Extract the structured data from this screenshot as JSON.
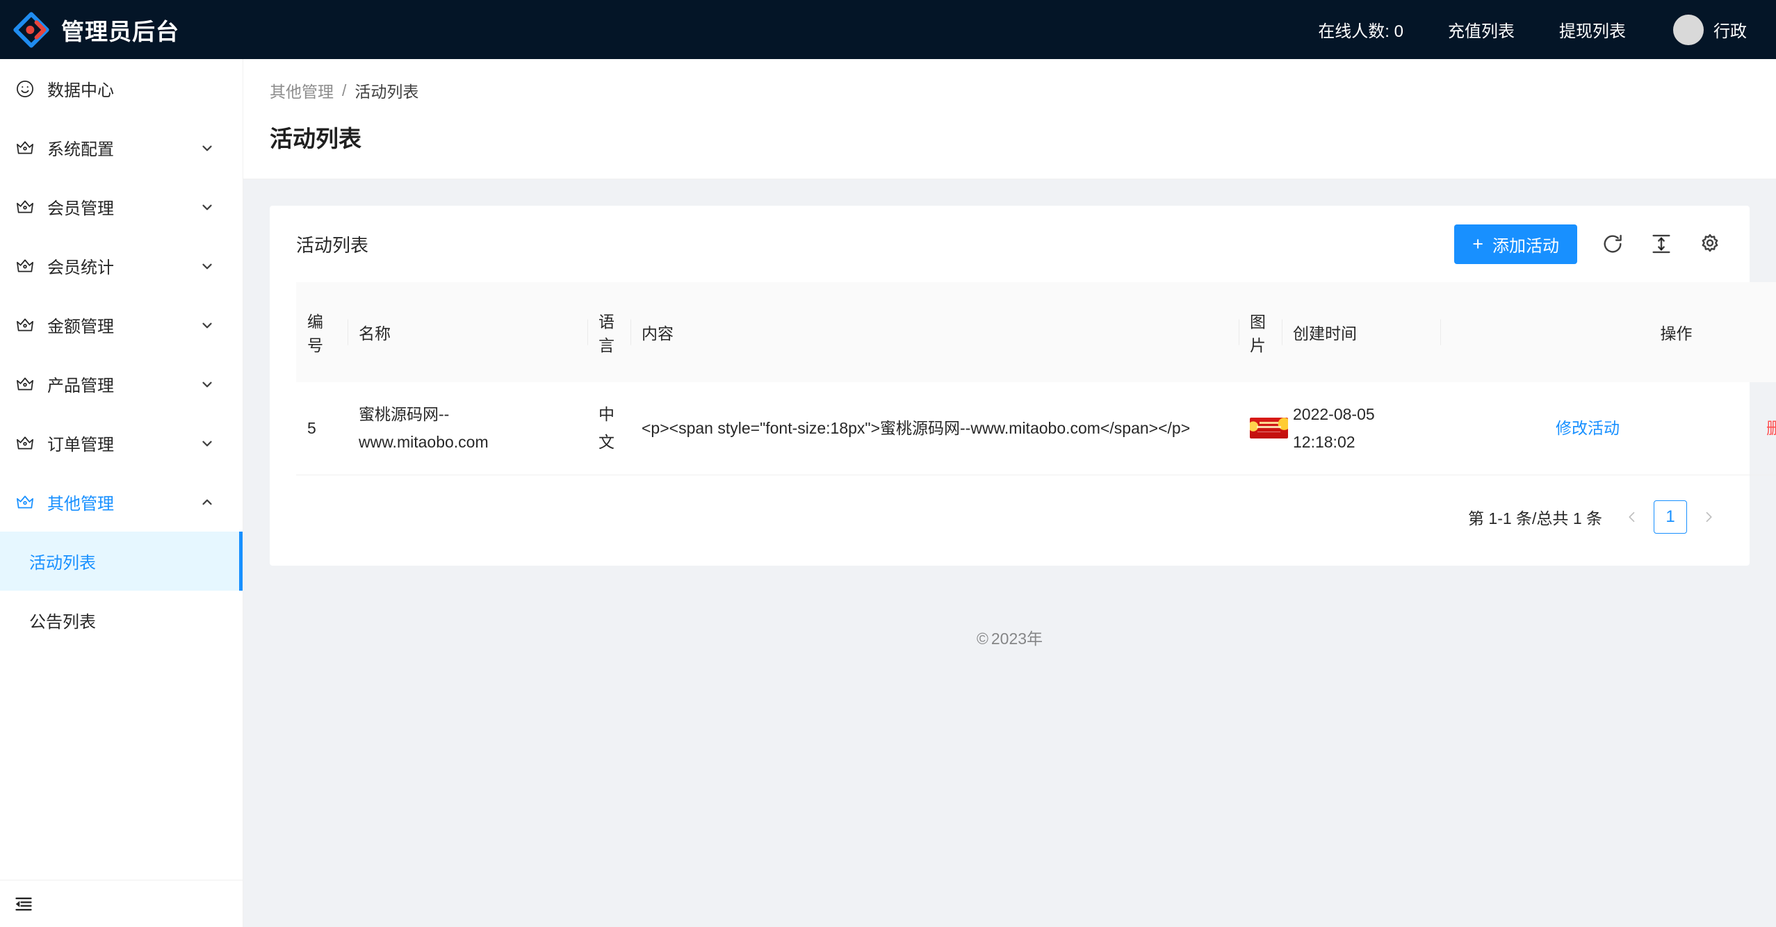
{
  "header": {
    "logo_icon": "ant-design-logo-icon",
    "title": "管理员后台",
    "online_label": "在线人数: 0",
    "recharge_label": "充值列表",
    "withdraw_label": "提现列表",
    "user_name": "行政",
    "avatar_icon": "avatar-icon",
    "bg_color": "#041527"
  },
  "sidebar": {
    "items": [
      {
        "label": "数据中心",
        "icon": "smiley-icon",
        "arrow": "",
        "expanded": false,
        "active": false
      },
      {
        "label": "系统配置",
        "icon": "crown-icon",
        "arrow": "chevron-down-icon",
        "expanded": false,
        "active": false
      },
      {
        "label": "会员管理",
        "icon": "crown-icon",
        "arrow": "chevron-down-icon",
        "expanded": false,
        "active": false
      },
      {
        "label": "会员统计",
        "icon": "crown-icon",
        "arrow": "chevron-down-icon",
        "expanded": false,
        "active": false
      },
      {
        "label": "金额管理",
        "icon": "crown-icon",
        "arrow": "chevron-down-icon",
        "expanded": false,
        "active": false
      },
      {
        "label": "产品管理",
        "icon": "crown-icon",
        "arrow": "chevron-down-icon",
        "expanded": false,
        "active": false
      },
      {
        "label": "订单管理",
        "icon": "crown-icon",
        "arrow": "chevron-down-icon",
        "expanded": false,
        "active": false
      },
      {
        "label": "其他管理",
        "icon": "crown-icon",
        "arrow": "chevron-up-icon",
        "expanded": true,
        "active": true
      }
    ],
    "submenu": [
      {
        "label": "活动列表",
        "selected": true
      },
      {
        "label": "公告列表",
        "selected": false
      }
    ],
    "collapse_icon": "menu-fold-icon",
    "active_color": "#1890ff",
    "selected_bg": "#e6f7ff"
  },
  "page": {
    "breadcrumb_parent": "其他管理",
    "breadcrumb_sep": "/",
    "breadcrumb_current": "活动列表",
    "title": "活动列表"
  },
  "card": {
    "title": "活动列表",
    "add_button_plus": "+",
    "add_button_label": "添加活动",
    "add_button_color": "#1890ff",
    "tools": [
      {
        "icon": "reload-icon",
        "name": "refresh-button"
      },
      {
        "icon": "column-height-icon",
        "name": "density-button"
      },
      {
        "icon": "gear-icon",
        "name": "settings-button"
      }
    ]
  },
  "table": {
    "columns": [
      {
        "key": "id",
        "label": "编号"
      },
      {
        "key": "name",
        "label": "名称"
      },
      {
        "key": "lang",
        "label": "语言"
      },
      {
        "key": "content",
        "label": "内容"
      },
      {
        "key": "image",
        "label": "图片"
      },
      {
        "key": "created_at",
        "label": "创建时间"
      },
      {
        "key": "gap",
        "label": ""
      },
      {
        "key": "action",
        "label": "操作"
      }
    ],
    "rows": [
      {
        "id": "5",
        "name": "蜜桃源码网--www.mitaobo.com",
        "lang": "中文",
        "content": "<p><span style=\"font-size:18px\">蜜桃源码网--www.mitaobo.com</span></p>",
        "image_icon": "red-banner-thumbnail",
        "created_at": "2022-08-05 12:18:02",
        "edit_label": "修改活动",
        "delete_label": "删除"
      }
    ]
  },
  "pagination": {
    "total_text": "第 1-1 条/总共 1 条",
    "prev_icon": "chevron-left-icon",
    "current_page": "1",
    "next_icon": "chevron-right-icon"
  },
  "footer": {
    "copyright_symbol": "©",
    "text": "2023年"
  }
}
